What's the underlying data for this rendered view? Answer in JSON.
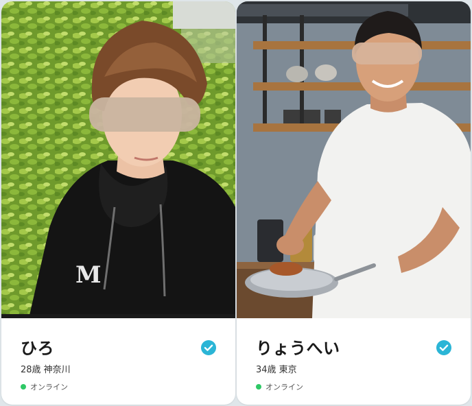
{
  "colors": {
    "verified": "#2bb5d6",
    "online": "#2ec866",
    "background": "#dfe6ea"
  },
  "profiles": [
    {
      "name": "ひろ",
      "age_location": "28歳 神奈川",
      "status": "オンライン",
      "verified_icon": "check-circle-icon"
    },
    {
      "name": "りょうへい",
      "age_location": "34歳 東京",
      "status": "オンライン",
      "verified_icon": "check-circle-icon"
    }
  ]
}
